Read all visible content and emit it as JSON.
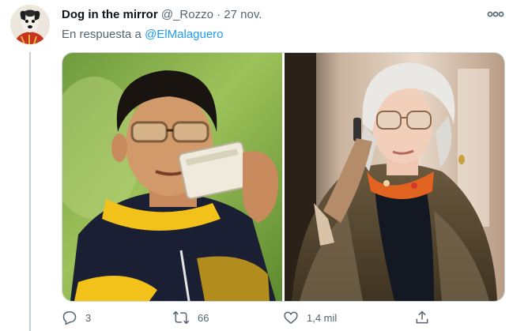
{
  "tweet": {
    "display_name": "Dog in the mirror",
    "handle": "@_Rozzo",
    "separator": "·",
    "date": "27 nov.",
    "reply_prefix": "En respuesta a",
    "reply_to": "@ElMalaguero"
  },
  "actions": {
    "reply_count": "3",
    "retweet_count": "66",
    "like_count": "1,4 mil"
  },
  "icons": [
    "avatar-dog",
    "more-icon",
    "reply-icon",
    "retweet-icon",
    "like-icon",
    "share-icon"
  ],
  "colors": {
    "link": "#1d9bf0",
    "muted": "#536471",
    "thread_line": "#c4cfd6"
  }
}
